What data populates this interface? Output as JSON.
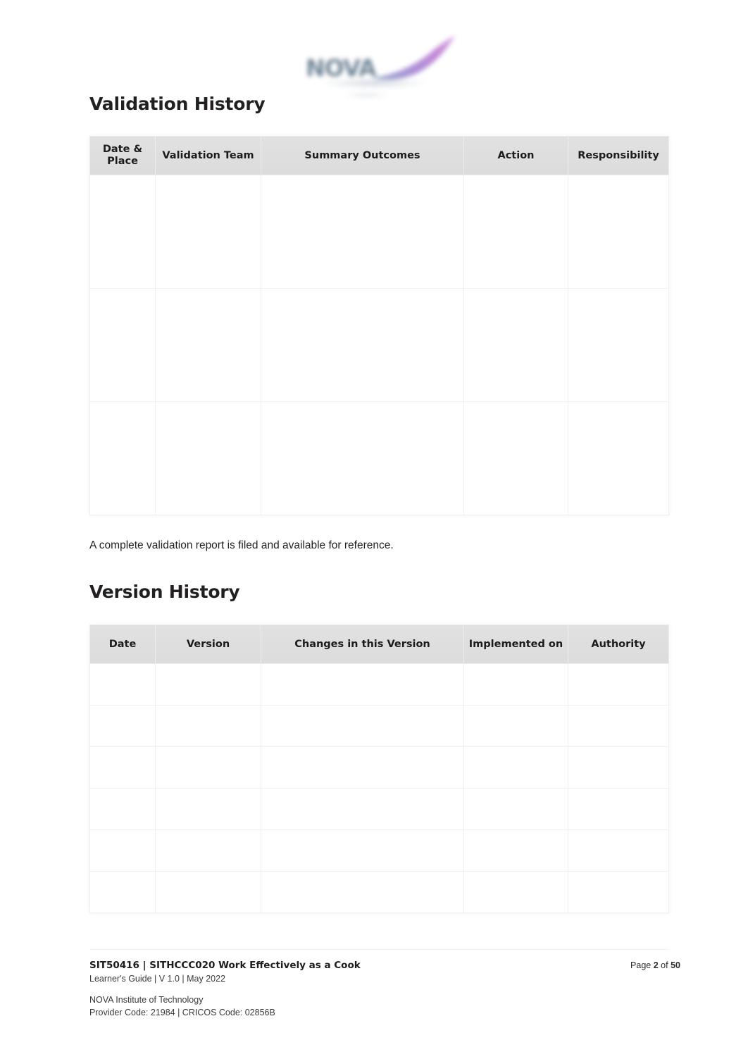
{
  "document": {
    "logo": {
      "wordmark": "NOVA",
      "swoosh_color": "#b06fd0",
      "wordmark_color": "#5a7186"
    },
    "sections": [
      {
        "id": "validation",
        "heading": "Validation History",
        "table": {
          "columns": [
            "Date & Place",
            "Validation Team",
            "Summary Outcomes",
            "Action",
            "Responsibility"
          ],
          "rows": [
            [
              "",
              "",
              "",
              "",
              ""
            ],
            [
              "",
              "",
              "",
              "",
              ""
            ],
            [
              "",
              "",
              "",
              "",
              ""
            ]
          ]
        },
        "note": "A complete validation report is filed and available for reference."
      },
      {
        "id": "version",
        "heading": "Version History",
        "table": {
          "columns": [
            "Date",
            "Version",
            "Changes in this Version",
            "Implemented on",
            "Authority"
          ],
          "rows": [
            [
              "",
              "",
              "",
              "",
              ""
            ],
            [
              "",
              "",
              "",
              "",
              ""
            ],
            [
              "",
              "",
              "",
              "",
              ""
            ],
            [
              "",
              "",
              "",
              "",
              ""
            ],
            [
              "",
              "",
              "",
              "",
              ""
            ],
            [
              "",
              "",
              "",
              "",
              ""
            ]
          ]
        }
      }
    ],
    "footer": {
      "course_title": "SIT50416 | SITHCCC020 Work Effectively as a Cook",
      "course_sub": "Learner's Guide | V 1.0 | May 2022",
      "page_label": "Page",
      "page_number": "2",
      "page_of": "of",
      "page_total": "50",
      "org_name": "NOVA Institute of Technology",
      "org_codes": "Provider Code: 21984 | CRICOS Code: 02856B"
    }
  }
}
